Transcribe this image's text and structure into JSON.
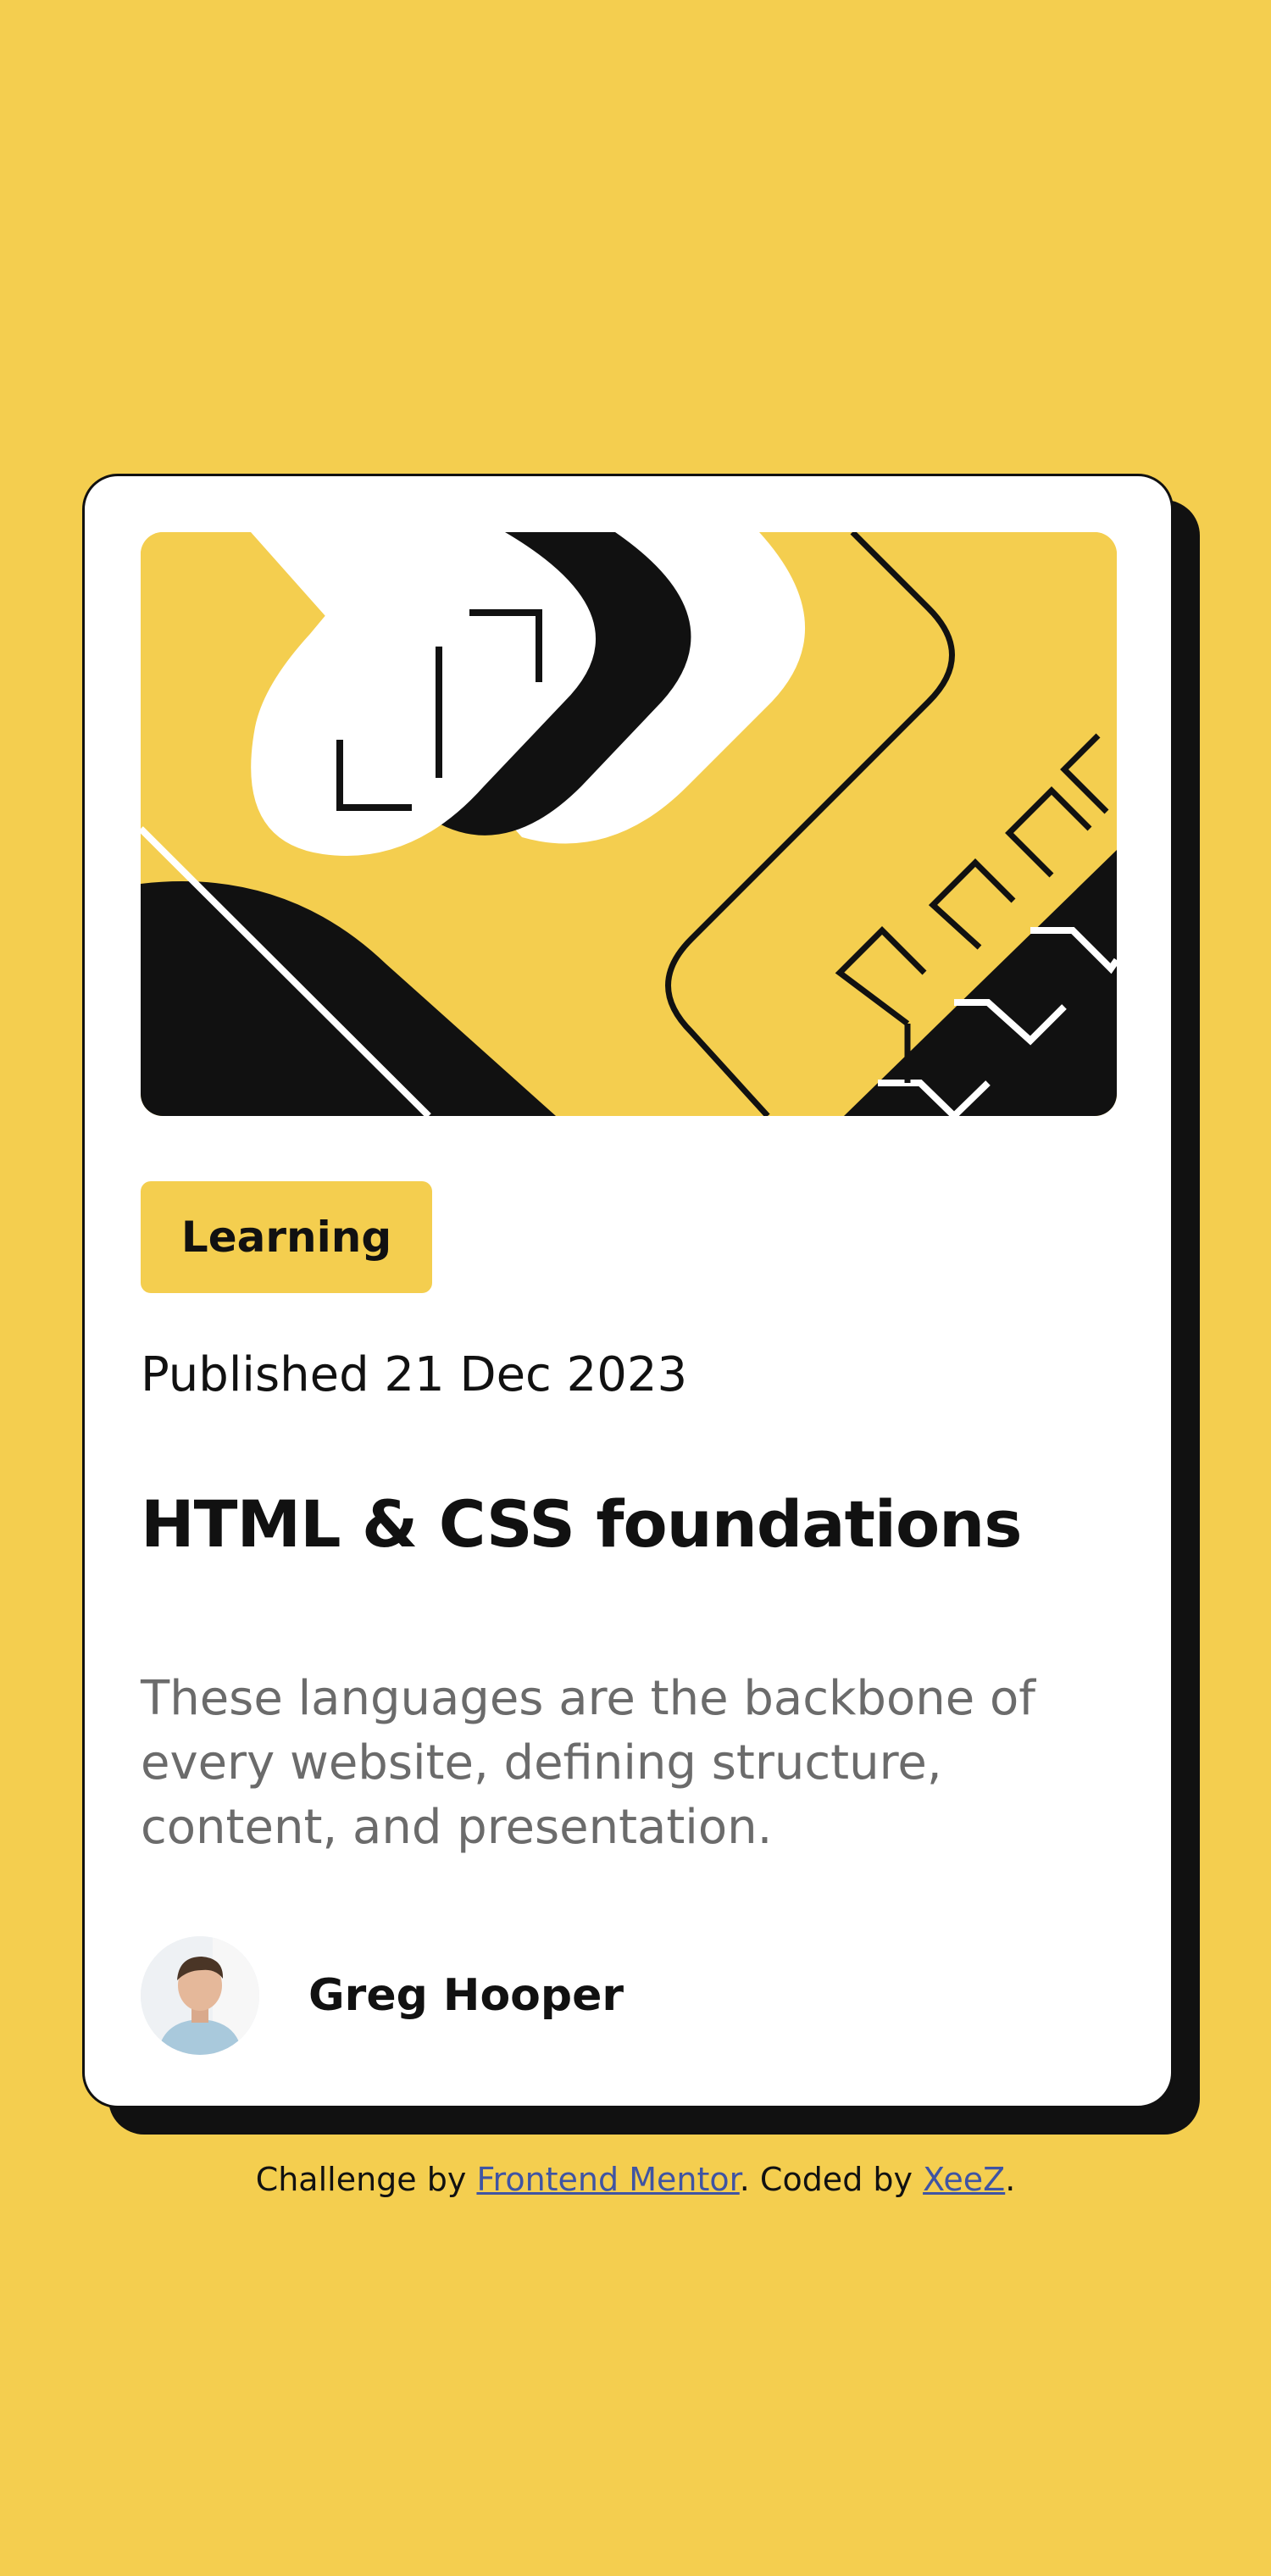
{
  "colors": {
    "background": "#F4CE4F",
    "card": "#FFFFFF",
    "ink": "#111111",
    "muted_text": "#6B6B6B",
    "link": "#3F54A3"
  },
  "card": {
    "illustration_icon": "abstract-illustration",
    "tag": "Learning",
    "published": "Published 21 Dec 2023",
    "title": "HTML & CSS foundations",
    "description": "These languages are the backbone of every website, defining structure, content, and presentation.",
    "author": {
      "avatar_icon": "avatar-photo",
      "name": "Greg Hooper"
    }
  },
  "attribution": {
    "prefix": "Challenge by ",
    "challenge_link": "Frontend Mentor",
    "middle": ". Coded by ",
    "coder_link": "XeeZ",
    "suffix": "."
  }
}
